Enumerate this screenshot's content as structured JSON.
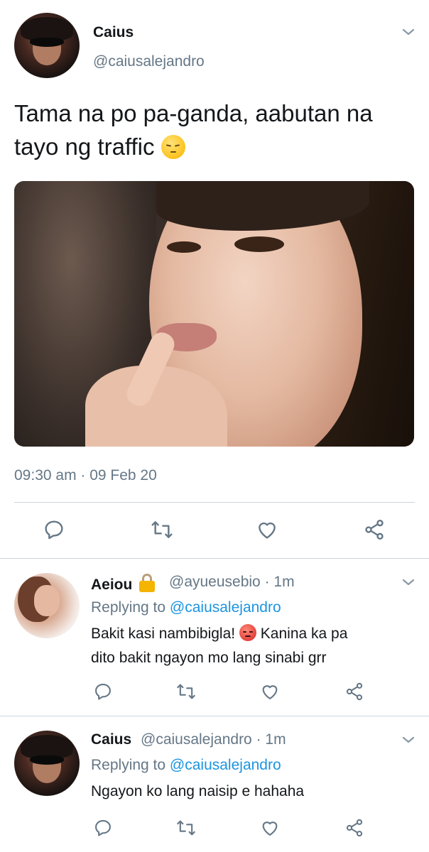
{
  "main_tweet": {
    "author_name": "Caius",
    "author_handle": "@caiusalejandro",
    "text_line1": "Tama na po pa-ganda, aabutan na",
    "text_line2": "tayo ng traffic",
    "text_emoji": "pensive-face-emoji",
    "timestamp": "09:30 am · 09 Feb 20"
  },
  "replies": [
    {
      "author_name": "Aeiou",
      "protected_icon": "lock-icon",
      "author_handle": "@ayueusebio",
      "time": "· 1m",
      "replying_label": "Replying to",
      "replying_to": "@caiusalejandro",
      "text_part1": "Bakit kasi nambibigla!",
      "text_emoji": "angry-face-emoji",
      "text_part2": "Kanina ka pa",
      "text_line2": "dito bakit ngayon mo lang sinabi grr"
    },
    {
      "author_name": "Caius",
      "author_handle": "@caiusalejandro",
      "time": "· 1m",
      "replying_label": "Replying to",
      "replying_to": "@caiusalejandro",
      "text": "Ngayon ko lang naisip e hahaha"
    }
  ],
  "icons": {
    "reply": "reply-icon",
    "retweet": "retweet-icon",
    "like": "heart-icon",
    "share": "share-icon",
    "more": "chevron-down-icon"
  },
  "colors": {
    "text": "#14171a",
    "secondary": "#657786",
    "link": "#1b95e0",
    "divider": "#ccd6dd"
  }
}
